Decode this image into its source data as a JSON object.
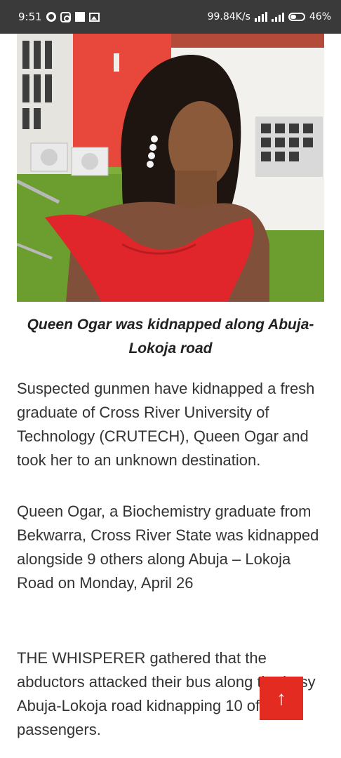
{
  "status_bar": {
    "time": "9:51",
    "network_speed": "99.84K/s",
    "battery_percent": "46%",
    "icons": [
      "opera-icon",
      "instagram-icon",
      "notification-square-icon",
      "gallery-icon",
      "signal-icon",
      "battery-icon"
    ]
  },
  "article": {
    "image_caption": "Queen Ogar was kidnapped along Abuja-Lokoja road",
    "paragraphs": [
      "Suspected gunmen have kidnapped a fresh graduate of Cross River University of Technology (CRUTECH), Queen Ogar and took her to an unknown destination.",
      "Queen Ogar, a Biochemistry graduate from Bekwarra, Cross River State was kidnapped alongside 9 others along Abuja – Lokoja Road on Monday, April 26",
      "THE WHISPERER gathered that the abductors attacked their bus along the busy Abuja-Lokoja road kidnapping 10 of the passengers."
    ]
  },
  "back_to_top": {
    "icon": "arrow-up-icon",
    "glyph": "↑",
    "color": "#e32b22"
  }
}
